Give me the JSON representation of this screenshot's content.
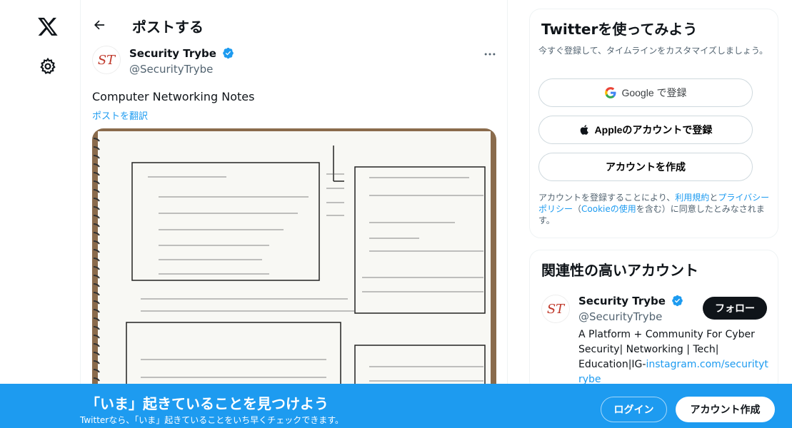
{
  "nav": {
    "logo_icon": "x-logo-icon",
    "settings_icon": "gear-icon"
  },
  "header": {
    "title": "ポストする"
  },
  "post": {
    "avatar_text": "ST",
    "author_name": "Security Trybe",
    "author_handle": "@SecurityTrybe",
    "text": "Computer Networking Notes",
    "translate_label": "ポストを翻訳"
  },
  "signup_card": {
    "title": "Twitterを使ってみよう",
    "subtitle": "今すぐ登録して、タイムラインをカスタマイズしましょう。",
    "google_label": "Google で登録",
    "apple_label": "Appleのアカウントで登録",
    "create_label": "アカウントを作成",
    "legal_prefix": "アカウントを登録することにより、",
    "legal_terms": "利用規約",
    "legal_and": "と",
    "legal_privacy": "プライバシーポリシー",
    "legal_open": "（",
    "legal_cookie": "Cookieの使用",
    "legal_suffix": "を含む）に同意したとみなされます。"
  },
  "related": {
    "title": "関連性の高いアカウント",
    "avatar_text": "ST",
    "name": "Security Trybe",
    "handle": "@SecurityTrybe",
    "follow_label": "フォロー",
    "bio_text": "A Platform + Community For Cyber Security| Networking | Tech| Education|IG-",
    "bio_link": "instagram.com/securitytrybe"
  },
  "banner": {
    "title": "「いま」起きていることを見つけよう",
    "subtitle": "Twitterなら、「いま」起きていることをいち早くチェックできます。",
    "login_label": "ログイン",
    "signup_label": "アカウント作成"
  },
  "colors": {
    "accent": "#1d9bf0",
    "text": "#0f1419",
    "muted": "#536471"
  }
}
